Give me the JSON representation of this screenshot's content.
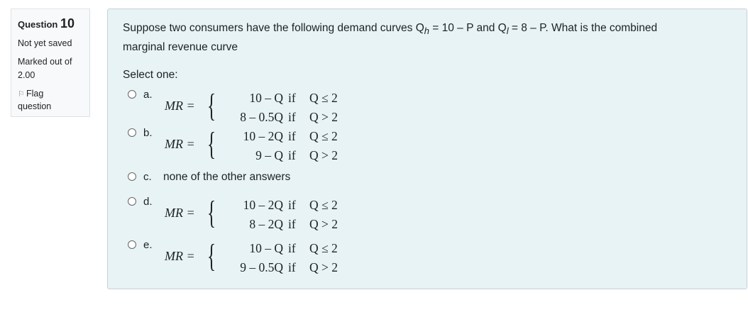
{
  "info": {
    "question_word": "Question",
    "question_number": "10",
    "state": "Not yet saved",
    "grade_line1": "Marked out of",
    "grade_line2": "2.00",
    "flag_line1": "Flag",
    "flag_line2": "question"
  },
  "question": {
    "text_line1": "Suppose two consumers have the following demand curves Q",
    "sub_h": "h",
    "text_line1b": " = 10 – P and Q",
    "sub_l": "l",
    "text_line1c": " = 8 – P.  What is the combined",
    "text_line2": "marginal revenue curve",
    "select_label": "Select one:"
  },
  "options": {
    "a": {
      "letter": "a.",
      "lhs": "MR =",
      "expr1": "10 – Q",
      "expr2": "8 – 0.5Q",
      "if": "if",
      "cond1": "Q ≤ 2",
      "cond2": "Q > 2"
    },
    "b": {
      "letter": "b.",
      "lhs": "MR =",
      "expr1": "10 – 2Q",
      "expr2": "9 – Q",
      "if": "if",
      "cond1": "Q ≤ 2",
      "cond2": "Q > 2"
    },
    "c": {
      "letter": "c.",
      "text": "none of the other answers"
    },
    "d": {
      "letter": "d.",
      "lhs": "MR =",
      "expr1": "10 – 2Q",
      "expr2": "8 – 2Q",
      "if": "if",
      "cond1": "Q ≤ 2",
      "cond2": "Q > 2"
    },
    "e": {
      "letter": "e.",
      "lhs": "MR =",
      "expr1": "10 – Q",
      "expr2": "9 – 0.5Q",
      "if": "if",
      "cond1": "Q ≤ 2",
      "cond2": "Q > 2"
    }
  },
  "colors": {
    "content_bg": "#e7f3f5",
    "info_bg": "#f8f9fa",
    "border": "#dee2e6"
  }
}
